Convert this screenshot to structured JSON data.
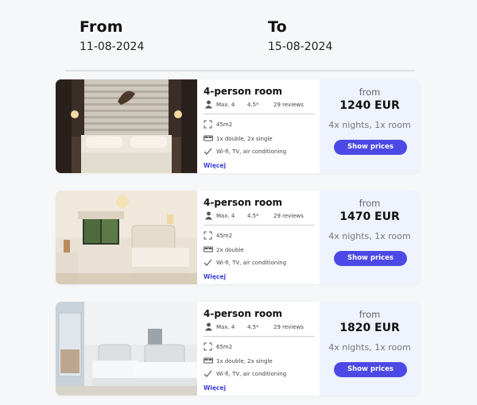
{
  "dates": {
    "from_label": "From",
    "from_value": "11-08-2024",
    "to_label": "To",
    "to_value": "15-08-2024"
  },
  "icons": [
    "person-icon",
    "area-icon",
    "bed-icon",
    "check-icon"
  ],
  "colors": {
    "accent": "#4c49e6",
    "price_panel": "#eef3fd",
    "link": "#3b3fd8"
  },
  "rooms": [
    {
      "title": "4-person room",
      "max": "Max. 4",
      "rating": "4.5*",
      "reviews": "29 reviews",
      "area": "45m2",
      "beds": "1x double, 2x single",
      "amenities": "Wi-fi, TV, air conditioning",
      "more": "Więcej",
      "price_from": "from",
      "price": "1240 EUR",
      "nights": "4x nights, 1x room",
      "button": "Show prices"
    },
    {
      "title": "4-person room",
      "max": "Max. 4",
      "rating": "4.5*",
      "reviews": "29 reviews",
      "area": "45m2",
      "beds": "2x double",
      "amenities": "Wi-fi, TV, air conditioning",
      "more": "Więcej",
      "price_from": "from",
      "price": "1470 EUR",
      "nights": "4x nights, 1x room",
      "button": "Show prices"
    },
    {
      "title": "4-person room",
      "max": "Max. 4",
      "rating": "4.5*",
      "reviews": "29 reviews",
      "area": "65m2",
      "beds": "1x double, 2x single",
      "amenities": "Wi-fi, TV, air conditioning",
      "more": "Więcej",
      "price_from": "from",
      "price": "1820 EUR",
      "nights": "4x nights, 1x room",
      "button": "Show prices"
    }
  ]
}
